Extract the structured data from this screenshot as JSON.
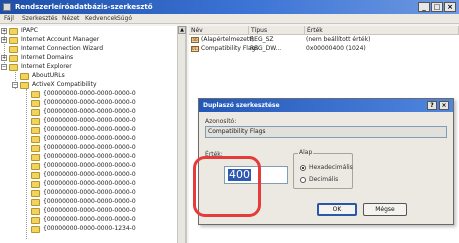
{
  "window": {
    "title": "Rendszerleíróadatbázis-szerkesztő",
    "controls": {
      "minimize": "_",
      "maximize": "□",
      "close": "×"
    },
    "title_color": "#2458b8"
  },
  "menu": [
    "Fájl",
    "Szerkesztés",
    "Nézet",
    "Kedvencek",
    "Súgó"
  ],
  "tree": {
    "items": [
      {
        "label": "IPAPC",
        "expander": "+"
      },
      {
        "label": "Internet Account Manager",
        "expander": "+"
      },
      {
        "label": "Internet Connection Wizard",
        "expander": ""
      },
      {
        "label": "Internet Domains",
        "expander": "+"
      },
      {
        "label": "Internet Explorer",
        "expander": "−"
      },
      {
        "label": "AboutURLs",
        "expander": ""
      },
      {
        "label": "ActiveX Compatibility",
        "expander": "−"
      },
      {
        "label": "{00000000-0000-0000-0000-0",
        "expander": ""
      },
      {
        "label": "{00000000-0000-0000-0000-0",
        "expander": ""
      },
      {
        "label": "{00000000-0000-0000-0000-0",
        "expander": ""
      },
      {
        "label": "{00000000-0000-0000-0000-0",
        "expander": ""
      },
      {
        "label": "{00000000-0000-0000-0000-0",
        "expander": ""
      },
      {
        "label": "{00000000-0000-0000-0000-0",
        "expander": ""
      },
      {
        "label": "{00000000-0000-0000-0000-0",
        "expander": ""
      },
      {
        "label": "{00000000-0000-0000-0000-0",
        "expander": ""
      },
      {
        "label": "{00000000-0000-0000-0000-0",
        "expander": ""
      },
      {
        "label": "{00000000-0000-0000-0000-0",
        "expander": ""
      },
      {
        "label": "{00000000-0000-0000-0000-0",
        "expander": ""
      },
      {
        "label": "{00000000-0000-0000-0000-0",
        "expander": ""
      },
      {
        "label": "{00000000-0000-0000-0000-0",
        "expander": ""
      },
      {
        "label": "{00000000-0000-0000-0000-0",
        "expander": ""
      },
      {
        "label": "{00000000-0000-0000-0000-0",
        "expander": ""
      },
      {
        "label": "{00000000-0000-0000-1234-0",
        "expander": ""
      }
    ]
  },
  "values": {
    "columns": [
      "Név",
      "Típus",
      "Érték"
    ],
    "rows": [
      {
        "icon": "ab",
        "name": "(Alapértelmezett)",
        "type": "REG_SZ",
        "value": "(nem beállított érték)"
      },
      {
        "icon": "011",
        "name": "Compatibility Flags",
        "type": "REG_DW...",
        "value": "0x00000400 (1024)"
      }
    ]
  },
  "dialog": {
    "title": "Duplaszó szerkesztése",
    "help": "?",
    "close": "×",
    "name_label": "Azonosító:",
    "name_value": "Compatibility Flags",
    "data_label": "Érték:",
    "data_value": "400",
    "base_label": "Alap",
    "base_options": [
      {
        "label": "Hexadecimális",
        "checked": true
      },
      {
        "label": "Decimális",
        "checked": false
      }
    ],
    "ok": "OK",
    "cancel": "Mégse"
  },
  "annotation": {
    "color": "#e53b3b"
  }
}
